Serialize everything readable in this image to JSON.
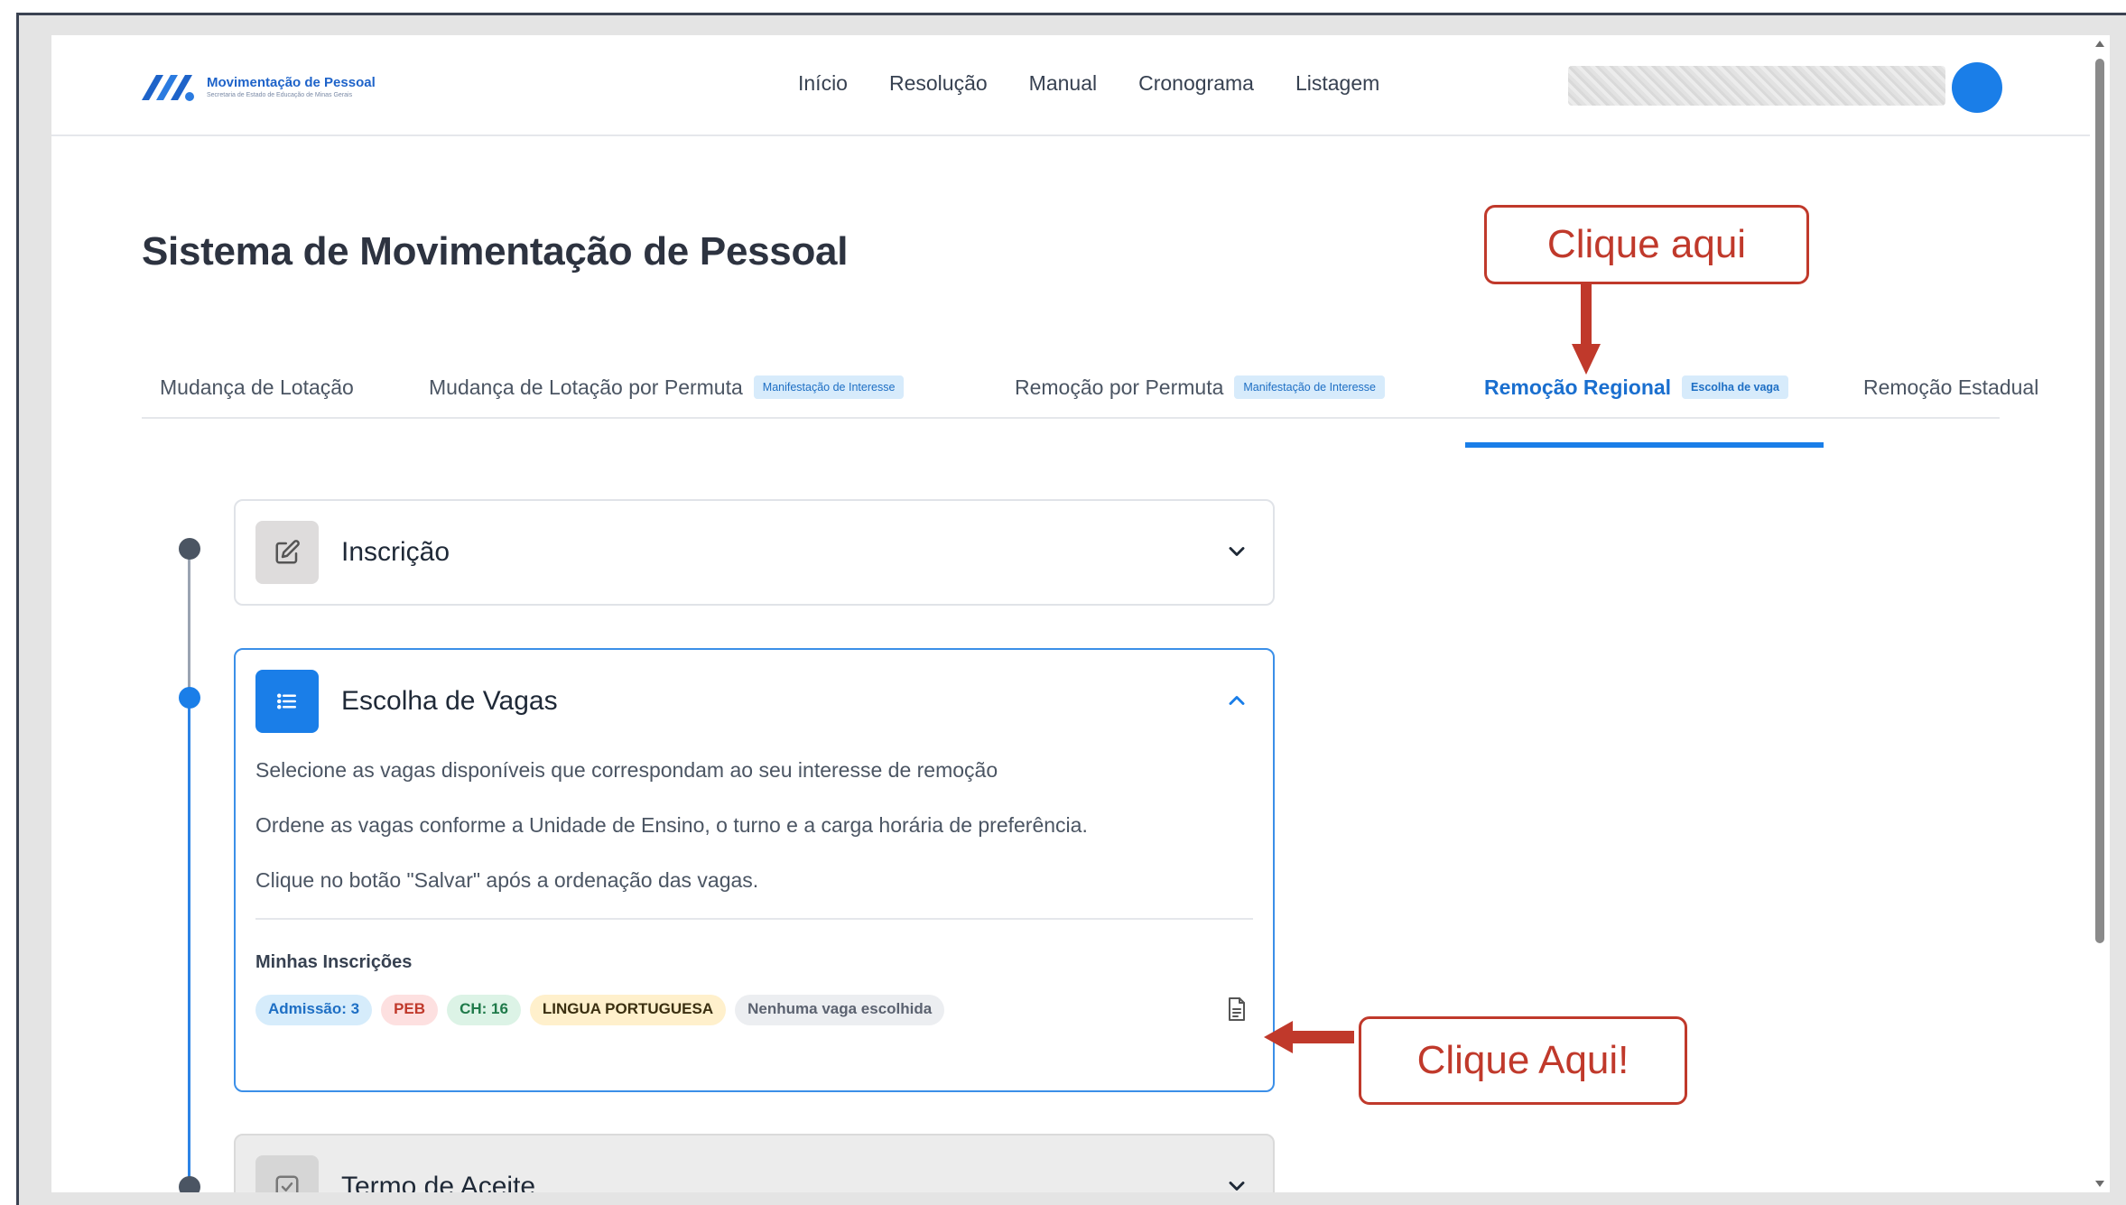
{
  "header": {
    "logo_title": "Movimentação de Pessoal",
    "logo_subtitle": "Secretaria de Estado de Educação de Minas Gerais",
    "nav": [
      "Início",
      "Resolução",
      "Manual",
      "Cronograma",
      "Listagem"
    ],
    "user_avatar_color": "#1a7ee8"
  },
  "page_title": "Sistema de Movimentação de Pessoal",
  "tabs": [
    {
      "label": "Mudança de Lotação",
      "badge": ""
    },
    {
      "label": "Mudança de Lotação por Permuta",
      "badge": "Manifestação de Interesse"
    },
    {
      "label": "Remoção por Permuta",
      "badge": "Manifestação de Interesse"
    },
    {
      "label": "Remoção Regional",
      "badge": "Escolha de vaga",
      "active": true
    },
    {
      "label": "Remoção Estadual",
      "badge": ""
    }
  ],
  "steps": [
    {
      "title": "Inscrição",
      "icon": "edit-icon",
      "state": "collapsed"
    },
    {
      "title": "Escolha de Vagas",
      "icon": "list-icon",
      "state": "expanded",
      "descriptions": [
        "Selecione as vagas disponíveis que correspondam ao seu interesse de remoção",
        "Ordene as vagas conforme a Unidade de Ensino, o turno e a carga horária de preferência.",
        "Clique no botão \"Salvar\" após a ordenação das vagas."
      ],
      "inscricoes_title": "Minhas Inscrições",
      "chips": [
        {
          "label": "Admissão: 3",
          "bg": "#d6ecfb",
          "fg": "#1e6fc4"
        },
        {
          "label": "PEB",
          "bg": "#fde0e0",
          "fg": "#c0392b"
        },
        {
          "label": "CH: 16",
          "bg": "#dcf3e6",
          "fg": "#1f7a4a"
        },
        {
          "label": "LINGUA PORTUGUESA",
          "bg": "#fff0cc",
          "fg": "#3b2f10"
        },
        {
          "label": "Nenhuma vaga escolhida",
          "bg": "#eceef1",
          "fg": "#5b6270"
        }
      ]
    },
    {
      "title": "Termo de Aceite",
      "icon": "check-square-icon",
      "state": "disabled"
    }
  ],
  "annotations": {
    "tab_callout": "Clique aqui",
    "doc_callout": "Clique Aqui!",
    "color": "#c0392b"
  }
}
